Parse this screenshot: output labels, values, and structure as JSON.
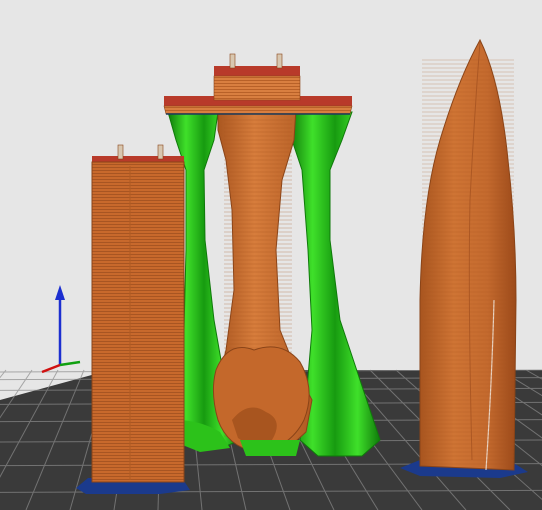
{
  "viewport": {
    "background": "#e6e6e6",
    "bed_color": "#3a3a3a",
    "bed_grid_color": "#8a8a8a"
  },
  "axes": {
    "x_color": "#d01010",
    "y_color": "#10a010",
    "z_color": "#1c2fd0"
  },
  "colors": {
    "model_orange": "#c8692c",
    "model_orange_light": "#df8a48",
    "model_orange_dark": "#9a4a1c",
    "support_green": "#2cc21a",
    "support_green_dark": "#0f7a0a",
    "top_red": "#b83a2a",
    "footprint_blue": "#1b3a8c"
  },
  "objects": [
    {
      "name": "left-prism",
      "kind": "model"
    },
    {
      "name": "center-column-with-crossbar",
      "kind": "model"
    },
    {
      "name": "support-left",
      "kind": "support"
    },
    {
      "name": "support-right",
      "kind": "support"
    },
    {
      "name": "right-pointed-tower",
      "kind": "model"
    }
  ]
}
